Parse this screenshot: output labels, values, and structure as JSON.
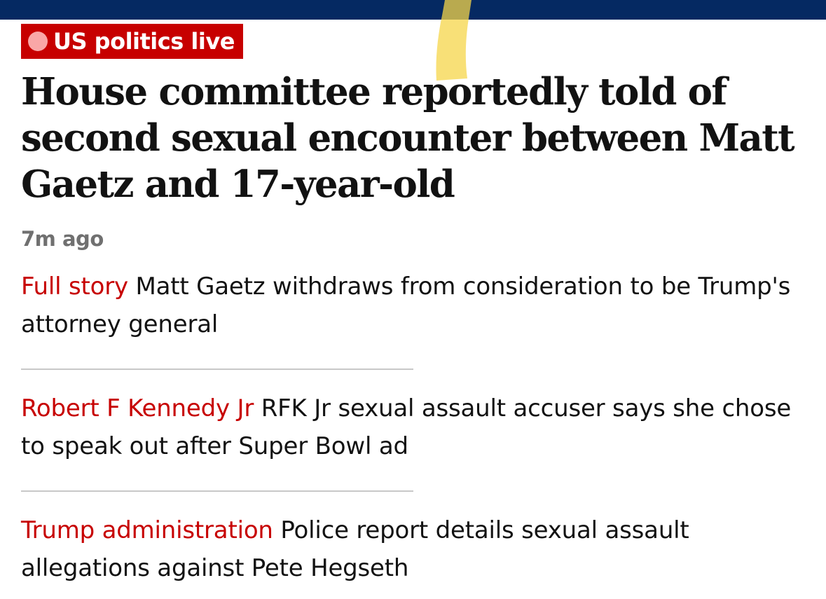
{
  "kicker": {
    "label": "US politics live"
  },
  "headline": "House committee reportedly told of second sexual encounter between Matt Gaetz and 17-year-old",
  "timestamp": "7m ago",
  "related": [
    {
      "tag": "Full story",
      "text": "Matt Gaetz withdraws from consideration to be Trump's attorney general"
    },
    {
      "tag": "Robert F Kennedy Jr",
      "text": "RFK Jr sexual assault accuser says she chose to speak out after Super Bowl ad"
    },
    {
      "tag": "Trump administration",
      "text": "Police report details sexual assault allegations against Pete Hegseth"
    }
  ],
  "colors": {
    "brand_navy": "#052962",
    "accent_red": "#c70000",
    "live_dot": "#f9a7a7",
    "timestamp_grey": "#707070",
    "text": "#121212"
  }
}
